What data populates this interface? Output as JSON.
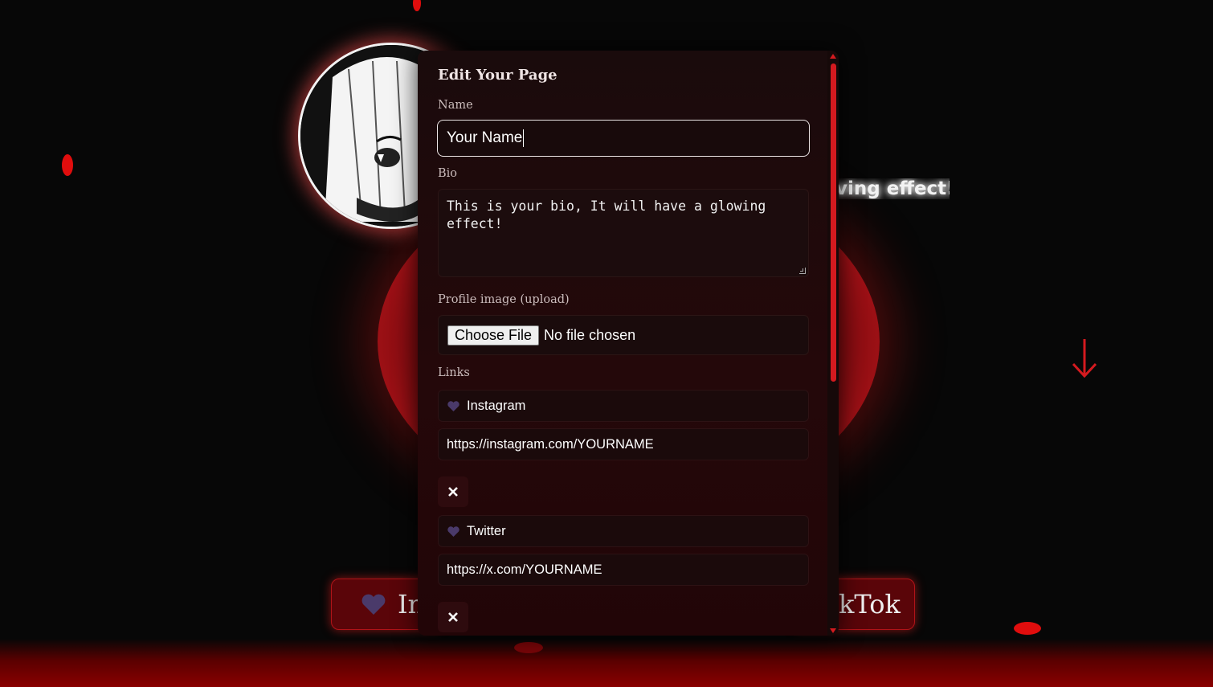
{
  "background": {
    "glow_text": "ving effect!",
    "accent_color": "#d41a1f",
    "buttons": [
      {
        "label": "In",
        "icon": "purple-heart-icon"
      },
      {
        "label": "kTok",
        "icon": ""
      }
    ]
  },
  "editor": {
    "title": "Edit Your Page",
    "name_label": "Name",
    "name_value": "Your Name",
    "bio_label": "Bio",
    "bio_value": "This is your bio, It will have a glowing effect!",
    "image_label": "Profile image (upload)",
    "file_button": "Choose File",
    "file_status": "No file chosen",
    "links_label": "Links",
    "links": [
      {
        "title": "Instagram",
        "icon": "purple-heart-icon",
        "url": "https://instagram.com/YOURNAME"
      },
      {
        "title": "Twitter",
        "icon": "purple-heart-icon",
        "url": "https://x.com/YOURNAME"
      }
    ],
    "remove_icon": "close-icon"
  }
}
